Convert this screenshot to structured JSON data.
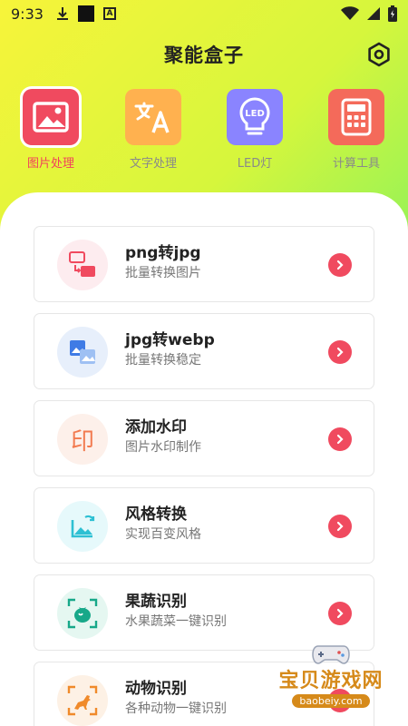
{
  "status_bar": {
    "time": "9:33",
    "a_badge": "A"
  },
  "header": {
    "title": "聚能盒子"
  },
  "tools": [
    {
      "label": "图片处理",
      "icon": "image-icon",
      "color": "#f04a5f",
      "active": true
    },
    {
      "label": "文字处理",
      "icon": "translate-icon",
      "color": "#ffb14f",
      "active": false
    },
    {
      "label": "LED灯",
      "icon": "led-bulb-icon",
      "color": "#8a84ff",
      "active": false
    },
    {
      "label": "计算工具",
      "icon": "calculator-icon",
      "color": "#f46a5a",
      "active": false
    }
  ],
  "tool_icon_text": {
    "led": "LED"
  },
  "features": [
    {
      "title": "png转jpg",
      "subtitle": "批量转换图片",
      "icon": "png-to-jpg-icon",
      "bg": "#fdecef"
    },
    {
      "title": "jpg转webp",
      "subtitle": "批量转换稳定",
      "icon": "jpg-to-webp-icon",
      "bg": "#e7effb"
    },
    {
      "title": "添加水印",
      "subtitle": "图片水印制作",
      "icon": "watermark-seal-icon",
      "bg": "#fdf0ea",
      "icon_text": "印"
    },
    {
      "title": "风格转换",
      "subtitle": "实现百变风格",
      "icon": "style-transfer-icon",
      "bg": "#e6f9fb"
    },
    {
      "title": "果蔬识别",
      "subtitle": "水果蔬菜一键识别",
      "icon": "fruit-scan-icon",
      "bg": "#e5f7f1"
    },
    {
      "title": "动物识别",
      "subtitle": "各种动物一键识别",
      "icon": "animal-scan-icon",
      "bg": "#fdf1e5"
    }
  ],
  "watermark": {
    "title": "宝贝游戏网",
    "url": "baobeiy.com"
  },
  "colors": {
    "accent": "#f04a5f",
    "panel": "#ffffff"
  }
}
